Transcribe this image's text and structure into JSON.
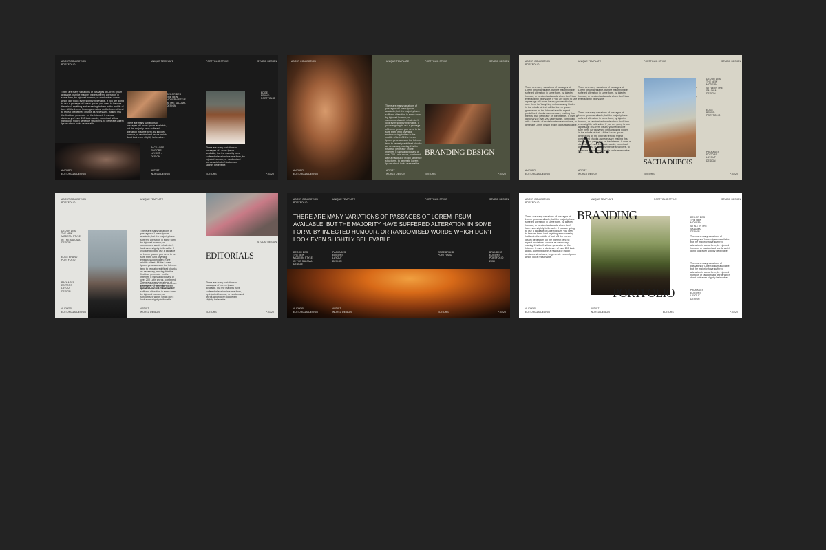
{
  "lorem": "There are many variations of passages of Lorem Ipsum available, but the majority have suffered alteration in some form, by injected humour, or randomised words which don't look even slightly believable. If you are going to use a passage of Lorem Ipsum, you need to be sure there isn't anything embarrassing hidden in the middle of text. All the Lorem Ipsum generators on the Internet tend to repeat predefined chunks as necessary, making this the first true generator on the Internet. It uses a dictionary of over 200 Latin words, combined with a handful of model sentence structures, to generate Lorem Ipsum which looks reasonable.",
  "lorem_short": "There are many variations of passages of Lorem Ipsum available, but the majority have suffered alteration in some form, by injected humour, or randomised words which don't look even slightly believable.",
  "common": {
    "about_collection": "ABOUT COLLECTION",
    "portfolio": "PORTFOLIO",
    "unique_template": "UNIQUE TEMPLATE",
    "portfolio_style": "PORTFOLIO STYLE",
    "studio_design": "STUDIO DESIGN",
    "author": "AUTHOR",
    "editorials_design": "EDITORIALS DESIGN",
    "artist": "ARTIST",
    "world_design": "WORLD DESIGN",
    "editors": "EDITORS",
    "page_no": "P.01/20",
    "new_modern": "DECOR DES THE NEW MODERN STYLE IN THE SALOMA DESIGN",
    "edge_brand": "EDGE BRAND PORTFOLIO",
    "packages": "PACKAGES EDITORS LAYOUT - DESIGN"
  },
  "slides": {
    "s2_title": "BRANDING DESIGN",
    "s3_big": "Aa.",
    "s3_name": "SACHA DUBOIS",
    "s4_title": "EDITORIALS",
    "s5_headline": "THERE ARE MANY VARIATIONS OF PASSAGES OF LOREM IPSUM AVAILABLE, BUT THE MAJORITY HAVE SUFFERED ALTERATION IN SOME FORM, BY INJECTED HUMOUR, OR RANDOMISED WORDS WHICH DON'T LOOK EVEN SLIGHTLY BELIEVABLE.",
    "s5_portfolio2030": "BRANDING EDITORS PORTFOLIO 2030",
    "s6_title1": "BRANDING",
    "s6_title2": "PORTFOLIO"
  },
  "colors": {
    "background": "#232323",
    "dark_slide": "#1a1a1a",
    "olive": "#4e5240",
    "beige": "#d8d5c8",
    "pale_grey": "#e4e4e0",
    "white": "#ffffff"
  },
  "icons": []
}
